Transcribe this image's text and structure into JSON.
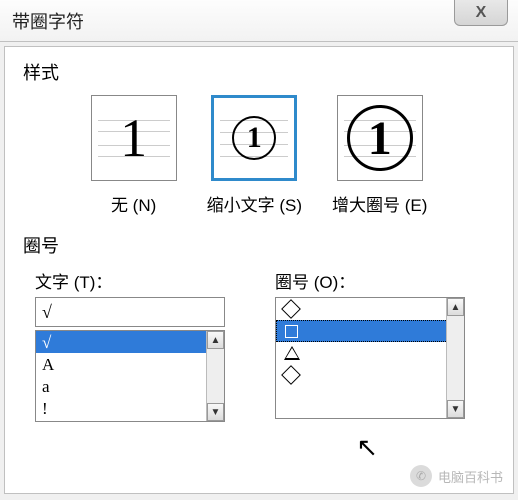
{
  "titlebar": {
    "title": "带圈字符",
    "close": "X"
  },
  "style_section": {
    "label": "样式",
    "options": [
      {
        "caption": "无 (N)"
      },
      {
        "caption": "缩小文字 (S)"
      },
      {
        "caption": "增大圈号 (E)"
      }
    ]
  },
  "enclosure_section": {
    "label": "圈号",
    "text_col": {
      "label": "文字 (T)：",
      "input_value": "√",
      "items": [
        "√",
        "A",
        "a",
        "!"
      ]
    },
    "shape_col": {
      "label": "圈号 (O)：",
      "items": [
        "◇",
        "□",
        "△",
        "◇"
      ]
    }
  },
  "watermark": "电脑百科书"
}
